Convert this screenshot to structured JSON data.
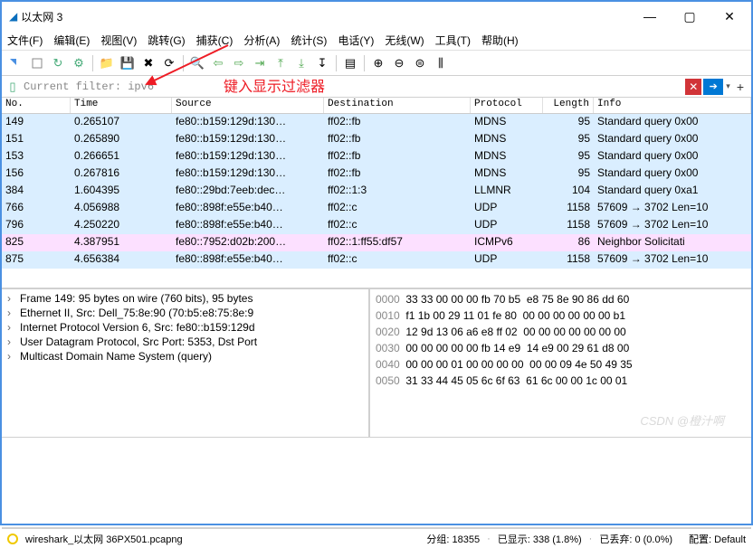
{
  "window": {
    "title": "以太网 3"
  },
  "menus": {
    "file": "文件(F)",
    "edit": "编辑(E)",
    "view": "视图(V)",
    "go": "跳转(G)",
    "capture": "捕获(C)",
    "analyze": "分析(A)",
    "stats": "统计(S)",
    "tel": "电话(Y)",
    "wireless": "无线(W)",
    "tools": "工具(T)",
    "help": "帮助(H)"
  },
  "filter": {
    "placeholder": "Current filter: ipv6"
  },
  "annotation": "键入显示过滤器",
  "columns": {
    "no": "No.",
    "time": "Time",
    "src": "Source",
    "dst": "Destination",
    "proto": "Protocol",
    "len": "Length",
    "info": "Info"
  },
  "rows": [
    {
      "cls": "sel mdns",
      "no": "149",
      "time": "0.265107",
      "src": "fe80::b159:129d:130…",
      "dst": "ff02::fb",
      "proto": "MDNS",
      "len": "95",
      "info": "Standard query 0x00"
    },
    {
      "cls": "mdns",
      "no": "151",
      "time": "0.265890",
      "src": "fe80::b159:129d:130…",
      "dst": "ff02::fb",
      "proto": "MDNS",
      "len": "95",
      "info": "Standard query 0x00"
    },
    {
      "cls": "mdns",
      "no": "153",
      "time": "0.266651",
      "src": "fe80::b159:129d:130…",
      "dst": "ff02::fb",
      "proto": "MDNS",
      "len": "95",
      "info": "Standard query 0x00"
    },
    {
      "cls": "mdns",
      "no": "156",
      "time": "0.267816",
      "src": "fe80::b159:129d:130…",
      "dst": "ff02::fb",
      "proto": "MDNS",
      "len": "95",
      "info": "Standard query 0x00"
    },
    {
      "cls": "mdns",
      "no": "384",
      "time": "1.604395",
      "src": "fe80::29bd:7eeb:dec…",
      "dst": "ff02::1:3",
      "proto": "LLMNR",
      "len": "104",
      "info": "Standard query 0xa1"
    },
    {
      "cls": "udp",
      "no": "766",
      "time": "4.056988",
      "src": "fe80::898f:e55e:b40…",
      "dst": "ff02::c",
      "proto": "UDP",
      "len": "1158",
      "info": "57609 → 3702 Len=10"
    },
    {
      "cls": "udp",
      "no": "796",
      "time": "4.250220",
      "src": "fe80::898f:e55e:b40…",
      "dst": "ff02::c",
      "proto": "UDP",
      "len": "1158",
      "info": "57609 → 3702 Len=10"
    },
    {
      "cls": "icmp",
      "no": "825",
      "time": "4.387951",
      "src": "fe80::7952:d02b:200…",
      "dst": "ff02::1:ff55:df57",
      "proto": "ICMPv6",
      "len": "86",
      "info": "Neighbor Solicitati"
    },
    {
      "cls": "udp",
      "no": "875",
      "time": "4.656384",
      "src": "fe80::898f:e55e:b40…",
      "dst": "ff02::c",
      "proto": "UDP",
      "len": "1158",
      "info": "57609 → 3702 Len=10"
    }
  ],
  "tree": [
    "Frame 149: 95 bytes on wire (760 bits), 95 bytes",
    "Ethernet II, Src: Dell_75:8e:90 (70:b5:e8:75:8e:9",
    "Internet Protocol Version 6, Src: fe80::b159:129d",
    "User Datagram Protocol, Src Port: 5353, Dst Port",
    "Multicast Domain Name System (query)"
  ],
  "hex": [
    {
      "off": "0000",
      "b": "33 33 00 00 00 fb 70 b5  e8 75 8e 90 86 dd 60"
    },
    {
      "off": "0010",
      "b": "f1 1b 00 29 11 01 fe 80  00 00 00 00 00 00 b1"
    },
    {
      "off": "0020",
      "b": "12 9d 13 06 a6 e8 ff 02  00 00 00 00 00 00 00"
    },
    {
      "off": "0030",
      "b": "00 00 00 00 00 fb 14 e9  14 e9 00 29 61 d8 00"
    },
    {
      "off": "0040",
      "b": "00 00 00 01 00 00 00 00  00 00 09 4e 50 49 35"
    },
    {
      "off": "0050",
      "b": "31 33 44 45 05 6c 6f 63  61 6c 00 00 1c 00 01"
    }
  ],
  "status": {
    "file": "wireshark_以太网 36PX501.pcapng",
    "pkts": "分组: 18355",
    "disp": "已显示: 338 (1.8%)",
    "drop": "已丢弃: 0 (0.0%)",
    "cfg": "配置: Default"
  },
  "watermark": "CSDN @橙汁啊"
}
